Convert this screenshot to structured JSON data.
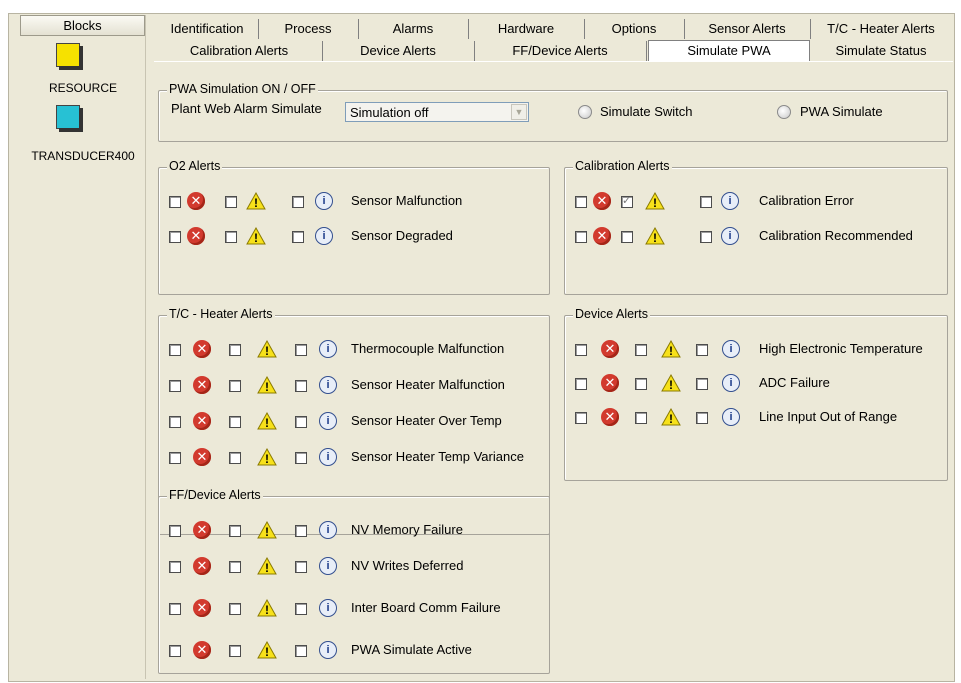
{
  "sidebar": {
    "header": "Blocks",
    "blocks": [
      {
        "label": "RESOURCE",
        "icon": "yellow-cube-icon",
        "color": "#f6e100"
      },
      {
        "label": "TRANSDUCER400",
        "icon": "cyan-cube-icon",
        "color": "#27c1d4"
      }
    ]
  },
  "tabs": {
    "row1": [
      "Identification",
      "Process",
      "Alarms",
      "Hardware",
      "Options",
      "Sensor Alerts",
      "T/C - Heater Alerts"
    ],
    "row2": [
      "Calibration Alerts",
      "Device Alerts",
      "FF/Device Alerts",
      "Simulate PWA",
      "Simulate Status"
    ],
    "active": "Simulate PWA"
  },
  "pwa_sim": {
    "legend": "PWA Simulation ON / OFF",
    "field_label": "Plant Web Alarm Simulate",
    "select_value": "Simulation off",
    "radio_switch": "Simulate Switch",
    "radio_pwa": "PWA Simulate"
  },
  "groups": {
    "o2": {
      "legend": "O2 Alerts",
      "items": [
        "Sensor Malfunction",
        "Sensor Degraded"
      ]
    },
    "calibration": {
      "legend": "Calibration Alerts",
      "items": [
        "Calibration Error",
        "Calibration Recommended"
      ]
    },
    "tc_heater": {
      "legend": "T/C - Heater Alerts",
      "items": [
        "Thermocouple Malfunction",
        "Sensor Heater Malfunction",
        "Sensor Heater Over Temp",
        "Sensor Heater Temp Variance"
      ]
    },
    "device": {
      "legend": "Device Alerts",
      "items": [
        "High Electronic Temperature",
        "ADC Failure",
        "Line Input Out of Range"
      ]
    },
    "ff_device": {
      "legend": "FF/Device Alerts",
      "items": [
        "NV Memory Failure",
        "NV Writes Deferred",
        "Inter Board Comm Failure",
        "PWA Simulate Active"
      ]
    }
  },
  "icons": {
    "error": "error-icon",
    "warning": "warning-icon",
    "info": "info-icon"
  },
  "colors": {
    "panel_bg": "#ece9d8",
    "error_red": "#d23a2e",
    "warning_yellow": "#f7e11a"
  }
}
